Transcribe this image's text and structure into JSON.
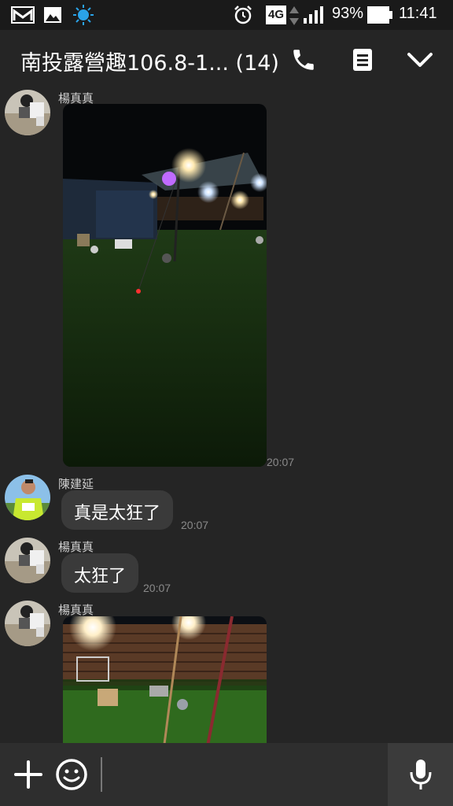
{
  "status_bar": {
    "network": "4G",
    "battery_percent": "93%",
    "time": "11:41"
  },
  "header": {
    "title": "南投露營趣106.8-1... (14)",
    "call_icon": "phone-icon",
    "notes_icon": "note-icon",
    "menu_icon": "chevron-down-icon"
  },
  "messages": [
    {
      "type": "image",
      "sender": "楊真真",
      "time": "20:07",
      "image_desc_icon": "photo-night-camp"
    },
    {
      "type": "text",
      "sender": "陳建延",
      "text": "真是太狂了",
      "time": "20:07"
    },
    {
      "type": "text",
      "sender": "楊真真",
      "text": "太狂了",
      "time": "20:07"
    },
    {
      "type": "image",
      "sender": "楊真真",
      "time": "",
      "image_desc_icon": "photo-camp-fence"
    }
  ],
  "input_bar": {
    "placeholder": "",
    "add_icon": "plus-icon",
    "emoji_icon": "smiley-icon",
    "mic_icon": "microphone-icon"
  },
  "colors": {
    "background": "#252525",
    "bubble": "#3a3a3a",
    "status_bar": "#1a1a1a"
  }
}
